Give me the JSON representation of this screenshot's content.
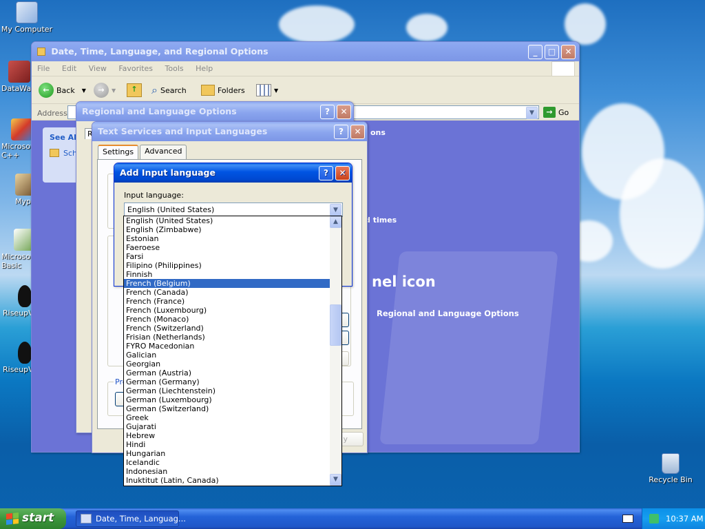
{
  "desktop": {
    "icons": [
      {
        "label": "My Computer"
      },
      {
        "label": "DataWar"
      },
      {
        "label": "Microsoft C++"
      },
      {
        "label": "Myp"
      },
      {
        "label": "Microsoft Basic"
      },
      {
        "label": "RiseupV"
      },
      {
        "label": "RiseupV"
      },
      {
        "label": "Recycle Bin"
      }
    ]
  },
  "explorer": {
    "title": "Date, Time, Language, and Regional Options",
    "menu": [
      "File",
      "Edit",
      "View",
      "Favorites",
      "Tools",
      "Help"
    ],
    "toolbar": {
      "back": "Back",
      "search": "Search",
      "folders": "Folders"
    },
    "address_label": "Address",
    "go_label": "Go",
    "see_also": "See Al",
    "see_also_item": "Sch",
    "body_texts": {
      "options": "ons",
      "times": "d times",
      "panel_icon": "nel icon",
      "regional_link": "Regional and Language Options"
    }
  },
  "regional_dialog": {
    "title": "Regional and Language Options",
    "tab_stub": "R"
  },
  "text_services_dialog": {
    "title": "Text Services and Input Languages",
    "tabs": [
      "Settings",
      "Advanced"
    ],
    "pref_stub": "Pre",
    "apply_stub": "y"
  },
  "add_input_dialog": {
    "title": "Add Input language",
    "input_language_label": "Input language:",
    "selected_value": "English (United States)",
    "options": [
      "English (United States)",
      "English (Zimbabwe)",
      "Estonian",
      "Faeroese",
      "Farsi",
      "Filipino (Philippines)",
      "Finnish",
      "French (Belgium)",
      "French (Canada)",
      "French (France)",
      "French (Luxembourg)",
      "French (Monaco)",
      "French (Switzerland)",
      "Frisian (Netherlands)",
      "FYRO Macedonian",
      "Galician",
      "Georgian",
      "German (Austria)",
      "German (Germany)",
      "German (Liechtenstein)",
      "German (Luxembourg)",
      "German (Switzerland)",
      "Greek",
      "Gujarati",
      "Hebrew",
      "Hindi",
      "Hungarian",
      "Icelandic",
      "Indonesian",
      "Inuktitut (Latin, Canada)"
    ],
    "highlighted_option": "French (Belgium)"
  },
  "taskbar": {
    "start_label": "start",
    "task_button": "Date, Time, Languag...",
    "clock": "10:37 AM"
  },
  "colors": {
    "selection": "#316ac5",
    "titlebar_active": "#0054e3",
    "control_panel_bg": "#6b73d6"
  }
}
